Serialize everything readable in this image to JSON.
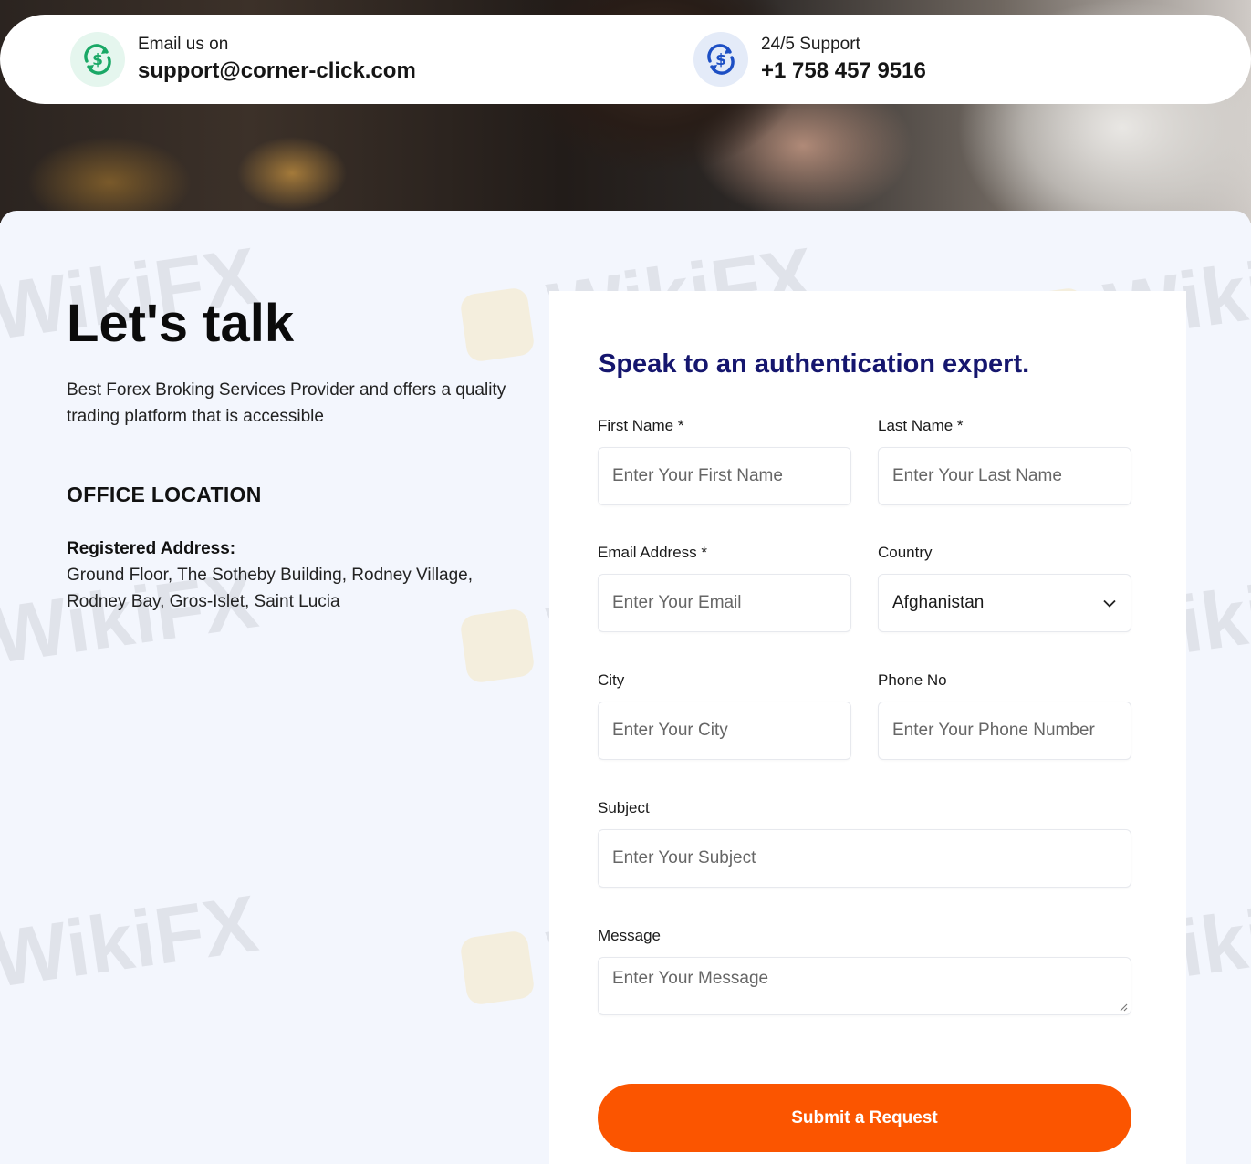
{
  "contact": {
    "email_label": "Email us on",
    "email_value": "support@corner-click.com",
    "support_label": "24/5 Support",
    "support_value": "+1 758 457 9516"
  },
  "intro": {
    "heading": "Let's talk",
    "description": "Best Forex Broking Services Provider and offers a quality trading platform that is accessible"
  },
  "office": {
    "title": "OFFICE LOCATION",
    "address_label": "Registered Address:",
    "address_line1": "Ground Floor, The Sotheby Building, Rodney Village,",
    "address_line2": "Rodney Bay, Gros-Islet, Saint Lucia"
  },
  "form": {
    "title": "Speak to an authentication expert.",
    "first_name": {
      "label": "First Name *",
      "placeholder": "Enter Your First Name"
    },
    "last_name": {
      "label": "Last Name *",
      "placeholder": "Enter Your Last Name"
    },
    "email": {
      "label": "Email Address *",
      "placeholder": "Enter Your Email"
    },
    "country": {
      "label": "Country",
      "value": "Afghanistan"
    },
    "city": {
      "label": "City",
      "placeholder": "Enter Your City"
    },
    "phone": {
      "label": "Phone No",
      "placeholder": "Enter Your Phone Number"
    },
    "subject": {
      "label": "Subject",
      "placeholder": "Enter Your Subject"
    },
    "message": {
      "label": "Message",
      "placeholder": "Enter Your Message"
    },
    "submit_label": "Submit a Request"
  },
  "watermark": {
    "text": "WikiFX"
  },
  "icons": {
    "email": "currency-exchange-icon",
    "support": "currency-exchange-icon",
    "country_select": "chevron-down-icon"
  },
  "colors": {
    "accent": "#fb5500",
    "form_title": "#15166e",
    "email_icon": "#1aa866",
    "support_icon": "#1d4fc4"
  }
}
